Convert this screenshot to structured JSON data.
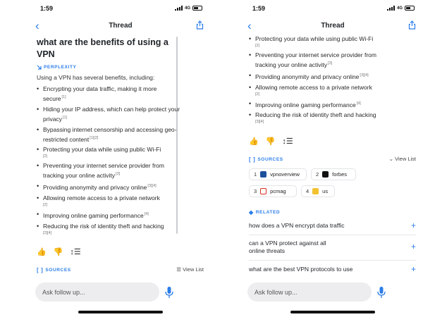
{
  "status": {
    "time": "1:59",
    "network": "4G"
  },
  "nav": {
    "title": "Thread",
    "back_glyph": "‹",
    "share_icon": "share-icon"
  },
  "question": "what are the benefits of using a VPN",
  "provider": "PERPLEXITY",
  "intro": "Using a VPN has several benefits, including:",
  "bullets_left": [
    {
      "text": "Encrypting your data traffic, making it more secure",
      "cite": "[1]"
    },
    {
      "text": "Hiding your IP address, which can help protect your privacy",
      "cite": "[1]"
    },
    {
      "text": "Bypassing internet censorship and accessing geo-restricted content",
      "cite": "[1][2]"
    },
    {
      "text": "Protecting your data while using public Wi-Fi",
      "cite": "[2]"
    },
    {
      "text": "Preventing your internet service provider from tracking your online activity",
      "cite": "[3]"
    },
    {
      "text": "Providing anonymity and privacy online",
      "cite": "[3][4]"
    },
    {
      "text": "Allowing remote access to a private network",
      "cite": "[2]"
    },
    {
      "text": "Improving online gaming performance",
      "cite": "[4]"
    },
    {
      "text": "Reducing the risk of identity theft and hacking",
      "cite": "[2][4]"
    }
  ],
  "bullets_right": [
    {
      "text": "Protecting your data while using public Wi-Fi",
      "cite": "[2]"
    },
    {
      "text": "Preventing your internet service provider from tracking your online activity",
      "cite": "[3]"
    },
    {
      "text": "Providing anonymity and privacy online",
      "cite": "[3][4]"
    },
    {
      "text": "Allowing remote access to a private network",
      "cite": "[2]"
    },
    {
      "text": "Improving online gaming performance",
      "cite": "[4]"
    },
    {
      "text": "Reducing the risk of identity theft and hacking",
      "cite": "[3][4]"
    }
  ],
  "actions": {
    "thumb_up": "👍",
    "thumb_down": "👎",
    "sort": "↕☰"
  },
  "sources": {
    "heading": "SOURCES",
    "view_list": "View List",
    "items": [
      {
        "num": "1",
        "name": "vpnoverview",
        "color": "#1d4f9c"
      },
      {
        "num": "2",
        "name": "forbes",
        "color": "#111111"
      },
      {
        "num": "3",
        "name": "pcmag",
        "color": "#d62d20"
      },
      {
        "num": "4",
        "name": "us",
        "color": "#f2c230"
      }
    ]
  },
  "related": {
    "heading": "RELATED",
    "items": [
      "how does a VPN encrypt data traffic",
      "can a VPN protect against all online threats",
      "what are the best VPN protocols to use"
    ]
  },
  "ask": {
    "placeholder": "Ask follow up..."
  },
  "colors": {
    "accent": "#2b7de9",
    "text": "#1f2328"
  }
}
